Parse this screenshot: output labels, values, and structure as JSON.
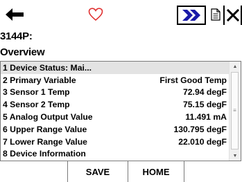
{
  "header": {
    "device_id": "3144P:",
    "screen_title": "Overview"
  },
  "toolbar": {
    "back_icon": "back-arrow-icon",
    "favorite_icon": "heart-icon",
    "forward_icon": "double-chevron-right-icon",
    "document_icon": "document-icon",
    "close_icon": "close-icon",
    "favorite_color": "#e03030",
    "forward_color": "#1a1aa8"
  },
  "list": {
    "items": [
      {
        "label": "1 Device Status: Mai...",
        "value": ""
      },
      {
        "label": "2 Primary Variable",
        "value": "First Good Temp"
      },
      {
        "label": "3 Sensor 1 Temp",
        "value": "72.94 degF"
      },
      {
        "label": "4 Sensor 2 Temp",
        "value": "75.15 degF"
      },
      {
        "label": "5 Analog Output Value",
        "value": "11.491 mA"
      },
      {
        "label": "6 Upper Range Value",
        "value": "130.795 degF"
      },
      {
        "label": "7 Lower Range Value",
        "value": "22.010 degF"
      },
      {
        "label": "8 Device Information",
        "value": ""
      }
    ],
    "selected_index": 0
  },
  "footer": {
    "save_label": "SAVE",
    "home_label": "HOME"
  }
}
